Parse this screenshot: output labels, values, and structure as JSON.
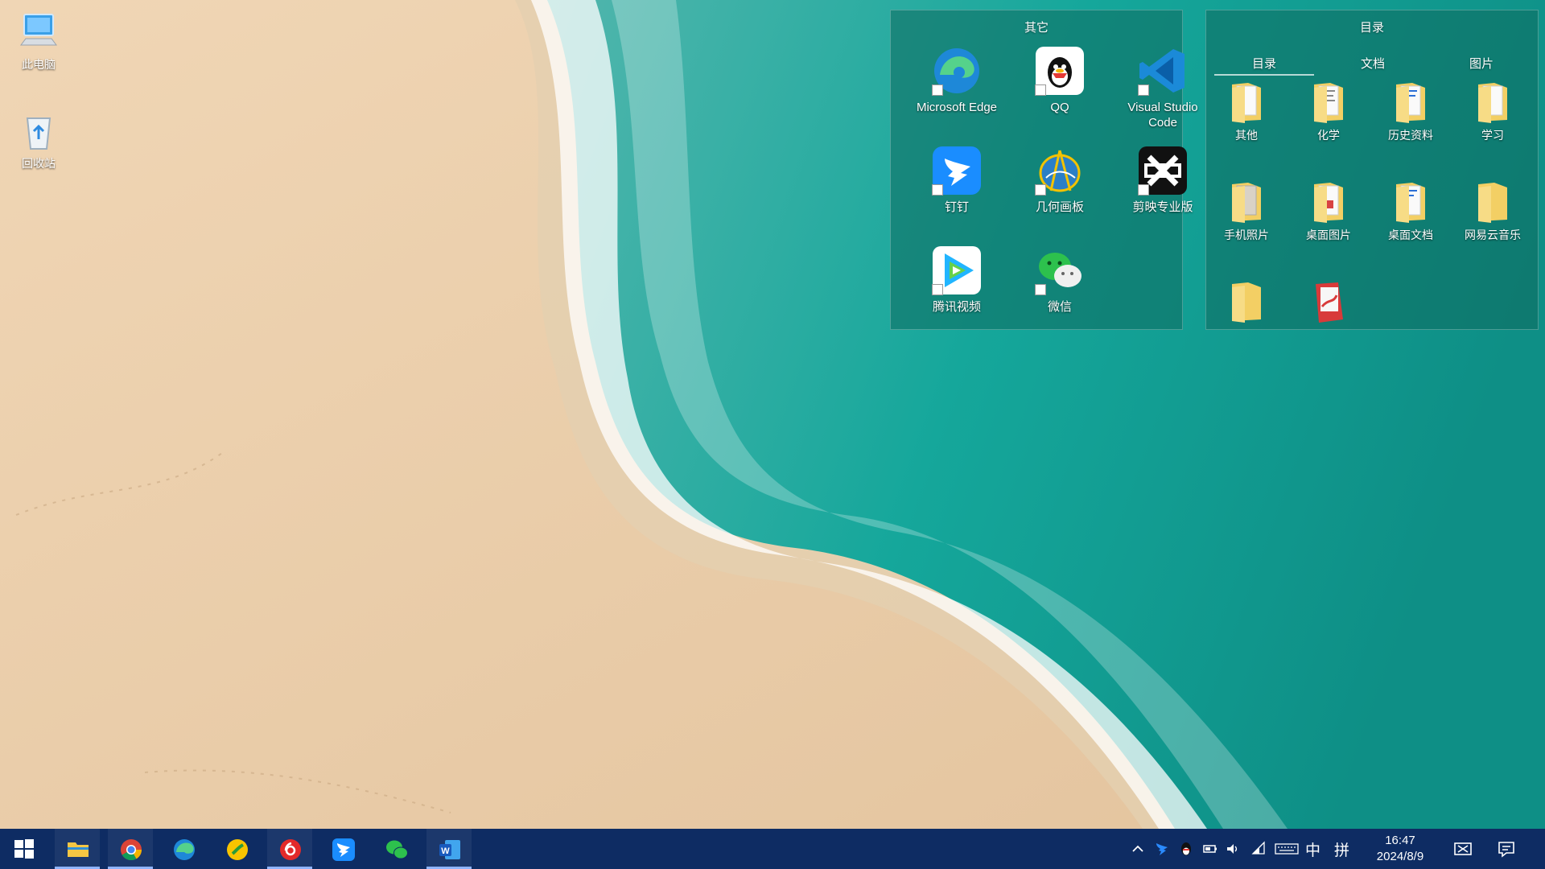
{
  "desktop": {
    "icons": [
      {
        "label": "此电脑",
        "icon": "computer-icon"
      },
      {
        "label": "回收站",
        "icon": "recycle-bin-icon"
      }
    ]
  },
  "fence_other": {
    "title": "其它",
    "apps": [
      {
        "label": "Microsoft Edge",
        "icon": "edge-icon"
      },
      {
        "label": "QQ",
        "icon": "qq-icon"
      },
      {
        "label": "Visual Studio Code",
        "icon": "vscode-icon"
      },
      {
        "label": "钉钉",
        "icon": "dingtalk-icon"
      },
      {
        "label": "几何画板",
        "icon": "geometer-sketchpad-icon"
      },
      {
        "label": "剪映专业版",
        "icon": "capcut-icon"
      },
      {
        "label": "腾讯视频",
        "icon": "tencent-video-icon"
      },
      {
        "label": "微信",
        "icon": "wechat-icon"
      }
    ]
  },
  "fence_dir": {
    "title": "目录",
    "tabs": [
      "目录",
      "文档",
      "图片"
    ],
    "active_tab": "目录",
    "folders": [
      "其他",
      "化学",
      "历史资料",
      "学习",
      "手机照片",
      "桌面图片",
      "桌面文档",
      "网易云音乐",
      "",
      ""
    ]
  },
  "taskbar": {
    "apps": [
      {
        "name": "file-explorer",
        "running": true
      },
      {
        "name": "chrome",
        "running": true
      },
      {
        "name": "edge",
        "running": false
      },
      {
        "name": "music-app",
        "running": false
      },
      {
        "name": "netease-cloud-music",
        "running": true
      },
      {
        "name": "dingtalk",
        "running": false
      },
      {
        "name": "wechat",
        "running": false
      },
      {
        "name": "word",
        "running": true
      }
    ],
    "ime_lang": "中",
    "ime_mode": "拼",
    "time": "16:47",
    "date": "2024/8/9"
  },
  "colors": {
    "taskbar": "#0e2c63",
    "panel": "#0f695f",
    "accent": "#8fb4ff"
  }
}
